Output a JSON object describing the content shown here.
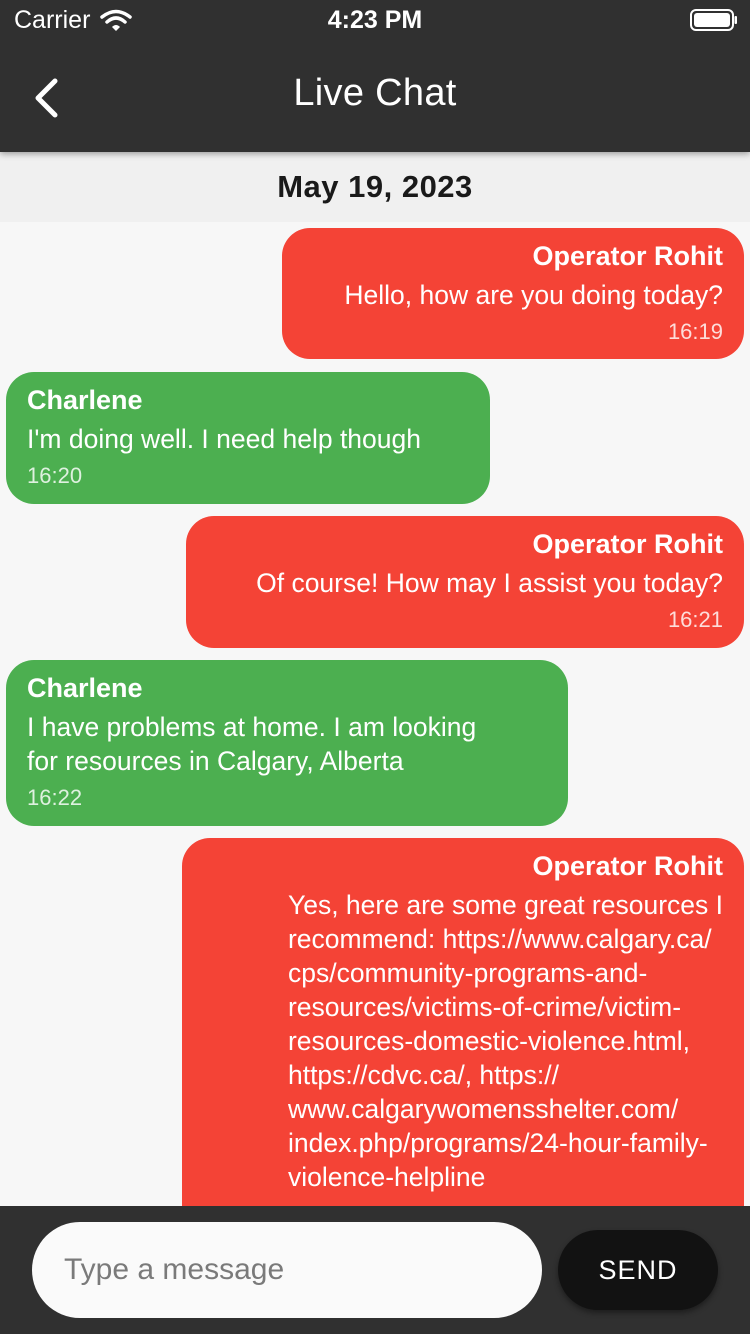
{
  "status_bar": {
    "carrier": "Carrier",
    "time": "4:23 PM",
    "wifi_icon": "wifi-icon",
    "battery_icon": "battery-icon"
  },
  "app_bar": {
    "title": "Live Chat",
    "back_icon": "chevron-left-icon",
    "background": "#303030"
  },
  "date_header": "May 19, 2023",
  "messages": [
    {
      "from": "operator",
      "sender": "Operator Rohit",
      "text": "Hello, how are you doing today?",
      "time": "16:19"
    },
    {
      "from": "user",
      "sender": "Charlene",
      "text": "I'm doing well. I need help though",
      "time": "16:20"
    },
    {
      "from": "operator",
      "sender": "Operator Rohit",
      "text": "Of course! How may I assist you today?",
      "time": "16:21"
    },
    {
      "from": "user",
      "sender": "Charlene",
      "text": "I have problems at home. I am looking\nfor resources in Calgary, Alberta",
      "time": "16:22"
    },
    {
      "from": "operator",
      "sender": "Operator Rohit",
      "text": "Yes, here are some great resources I\nrecommend: https://www.calgary.ca/\ncps/community-programs-and-\nresources/victims-of-crime/victim-\nresources-domestic-violence.html,\nhttps://cdvc.ca/, https://\nwww.calgarywomensshelter.com/\nindex.php/programs/24-hour-family-\nviolence-helpline",
      "time": ""
    }
  ],
  "colors": {
    "operator_bubble": "#f44336",
    "user_bubble": "#4caf50",
    "bar": "#303030",
    "send_button": "#121212"
  },
  "composer": {
    "placeholder": "Type a message",
    "value": "",
    "send_label": "SEND"
  }
}
